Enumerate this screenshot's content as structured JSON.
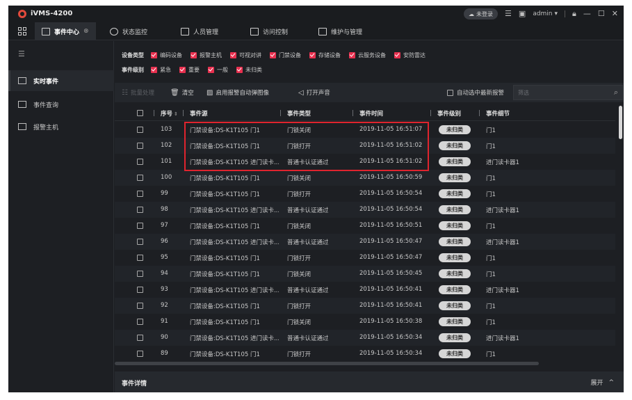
{
  "app": {
    "title": "iVMS-4200",
    "login_status": "未登录",
    "user": "admin",
    "user_caret": "▾"
  },
  "nav": {
    "tabs": [
      {
        "label": "事件中心",
        "active": true,
        "close": "⊗"
      },
      {
        "label": "状态监控"
      },
      {
        "label": "人员管理"
      },
      {
        "label": "访问控制"
      },
      {
        "label": "维护与管理"
      }
    ]
  },
  "sidebar": {
    "items": [
      {
        "label": "实时事件",
        "active": true
      },
      {
        "label": "事件查询"
      },
      {
        "label": "报警主机"
      }
    ]
  },
  "filters": {
    "device_type": {
      "label": "设备类型",
      "options": [
        "编码设备",
        "报警主机",
        "可视对讲",
        "门禁设备",
        "存储设备",
        "云服务设备",
        "安防雷达"
      ]
    },
    "event_level": {
      "label": "事件级别",
      "options": [
        "紧急",
        "重要",
        "一般",
        "未归类"
      ]
    }
  },
  "toolbar": {
    "batch_process": "批量处理",
    "clear": "清空",
    "auto_popup": "启用报警自动弹图像",
    "open_sound": "打开声音",
    "auto_select_latest": "自动选中最新报警",
    "search_placeholder": "筛选"
  },
  "table": {
    "headers": {
      "seq": "序号",
      "source": "事件源",
      "type": "事件类型",
      "time": "事件时间",
      "level": "事件级别",
      "detail": "事件细节"
    },
    "rows": [
      {
        "seq": "103",
        "source": "门禁设备:DS-K1T105 门1",
        "type": "门锁关闭",
        "time": "2019-11-05 16:51:07",
        "level": "未归类",
        "detail": "门1"
      },
      {
        "seq": "102",
        "source": "门禁设备:DS-K1T105 门1",
        "type": "门锁打开",
        "time": "2019-11-05 16:51:02",
        "level": "未归类",
        "detail": "门1"
      },
      {
        "seq": "101",
        "source": "门禁设备:DS-K1T105 进门读卡...",
        "type": "普通卡认证通过",
        "time": "2019-11-05 16:51:02",
        "level": "未归类",
        "detail": "进门读卡器1"
      },
      {
        "seq": "100",
        "source": "门禁设备:DS-K1T105 门1",
        "type": "门锁关闭",
        "time": "2019-11-05 16:50:59",
        "level": "未归类",
        "detail": "门1"
      },
      {
        "seq": "99",
        "source": "门禁设备:DS-K1T105 门1",
        "type": "门锁打开",
        "time": "2019-11-05 16:50:54",
        "level": "未归类",
        "detail": "门1"
      },
      {
        "seq": "98",
        "source": "门禁设备:DS-K1T105 进门读卡...",
        "type": "普通卡认证通过",
        "time": "2019-11-05 16:50:54",
        "level": "未归类",
        "detail": "进门读卡器1"
      },
      {
        "seq": "97",
        "source": "门禁设备:DS-K1T105 门1",
        "type": "门锁关闭",
        "time": "2019-11-05 16:50:51",
        "level": "未归类",
        "detail": "门1"
      },
      {
        "seq": "96",
        "source": "门禁设备:DS-K1T105 进门读卡...",
        "type": "普通卡认证通过",
        "time": "2019-11-05 16:50:47",
        "level": "未归类",
        "detail": "进门读卡器1"
      },
      {
        "seq": "95",
        "source": "门禁设备:DS-K1T105 门1",
        "type": "门锁打开",
        "time": "2019-11-05 16:50:47",
        "level": "未归类",
        "detail": "门1"
      },
      {
        "seq": "94",
        "source": "门禁设备:DS-K1T105 门1",
        "type": "门锁关闭",
        "time": "2019-11-05 16:50:45",
        "level": "未归类",
        "detail": "门1"
      },
      {
        "seq": "93",
        "source": "门禁设备:DS-K1T105 进门读卡...",
        "type": "普通卡认证通过",
        "time": "2019-11-05 16:50:41",
        "level": "未归类",
        "detail": "进门读卡器1"
      },
      {
        "seq": "92",
        "source": "门禁设备:DS-K1T105 门1",
        "type": "门锁打开",
        "time": "2019-11-05 16:50:41",
        "level": "未归类",
        "detail": "门1"
      },
      {
        "seq": "91",
        "source": "门禁设备:DS-K1T105 门1",
        "type": "门锁关闭",
        "time": "2019-11-05 16:50:38",
        "level": "未归类",
        "detail": "门1"
      },
      {
        "seq": "90",
        "source": "门禁设备:DS-K1T105 进门读卡...",
        "type": "普通卡认证通过",
        "time": "2019-11-05 16:50:34",
        "level": "未归类",
        "detail": "进门读卡器1"
      },
      {
        "seq": "89",
        "source": "门禁设备:DS-K1T105 门1",
        "type": "门锁打开",
        "time": "2019-11-05 16:50:34",
        "level": "未归类",
        "detail": "门1"
      }
    ]
  },
  "detail": {
    "title": "事件详情",
    "expand_label": "展开",
    "expand_icon": "^"
  },
  "colors": {
    "checked_red": "#e8304f",
    "highlight_red": "#e0242e",
    "background": "#1d1f23"
  }
}
